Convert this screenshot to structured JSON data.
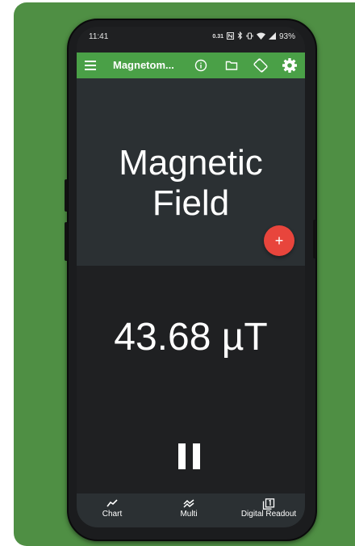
{
  "status_bar": {
    "time": "11:41",
    "data_speed": "0.31",
    "battery": "93%"
  },
  "app_bar": {
    "title": "Magnetom...",
    "icons": [
      "menu-icon",
      "info-icon",
      "folder-icon",
      "screen-rotation-icon",
      "settings-icon"
    ]
  },
  "hero": {
    "title_line1": "Magnetic",
    "title_line2": "Field"
  },
  "fab": {
    "label": "+"
  },
  "reading": {
    "value": "43.68 µT"
  },
  "bottom_nav": {
    "items": [
      {
        "label": "Chart",
        "icon": "chart-icon"
      },
      {
        "label": "Multi",
        "icon": "multi-icon"
      },
      {
        "label": "Digital Readout",
        "icon": "digital-readout-icon"
      }
    ]
  },
  "colors": {
    "app_bar": "#4aa047",
    "fab": "#e8453c",
    "backdrop": "#4f8f44",
    "hero_bg": "#2b3033",
    "screen_bg": "#1f2022"
  }
}
